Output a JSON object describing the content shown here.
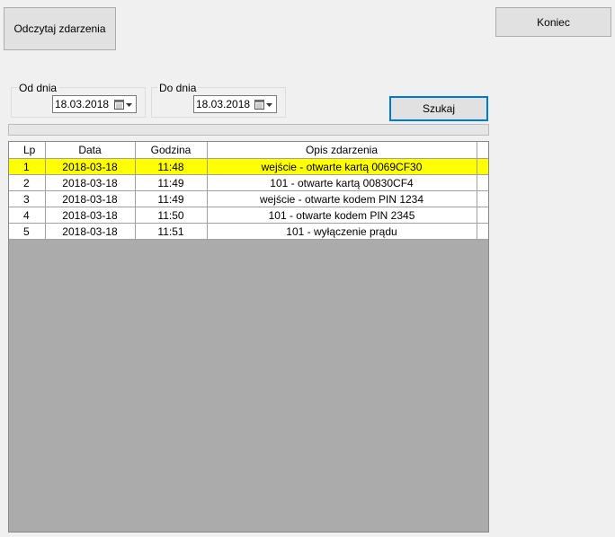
{
  "buttons": {
    "read_events": "Odczytaj zdarzenia",
    "end": "Koniec",
    "search": "Szukaj"
  },
  "from_group": {
    "label": "Od dnia",
    "value": "18.03.2018"
  },
  "to_group": {
    "label": "Do dnia",
    "value": "18.03.2018"
  },
  "progress": {
    "value_percent": 0,
    "fill_color": "#06b025"
  },
  "grid": {
    "headers": [
      "Lp",
      "Data",
      "Godzina",
      "Opis zdarzenia"
    ],
    "selected_row": 0,
    "selected_color": "#ffff00",
    "rows": [
      {
        "lp": "1",
        "date": "2018-03-18",
        "time": "11:48",
        "desc": "wejście - otwarte kartą 0069CF30"
      },
      {
        "lp": "2",
        "date": "2018-03-18",
        "time": "11:49",
        "desc": "101 - otwarte kartą 00830CF4"
      },
      {
        "lp": "3",
        "date": "2018-03-18",
        "time": "11:49",
        "desc": "wejście - otwarte kodem PIN 1234"
      },
      {
        "lp": "4",
        "date": "2018-03-18",
        "time": "11:50",
        "desc": "101 - otwarte kodem PIN 2345"
      },
      {
        "lp": "5",
        "date": "2018-03-18",
        "time": "11:51",
        "desc": "101 - wyłączenie prądu"
      }
    ]
  },
  "icons": {
    "calendar": "calendar-icon",
    "dropdown": "dropdown-arrow-icon"
  }
}
